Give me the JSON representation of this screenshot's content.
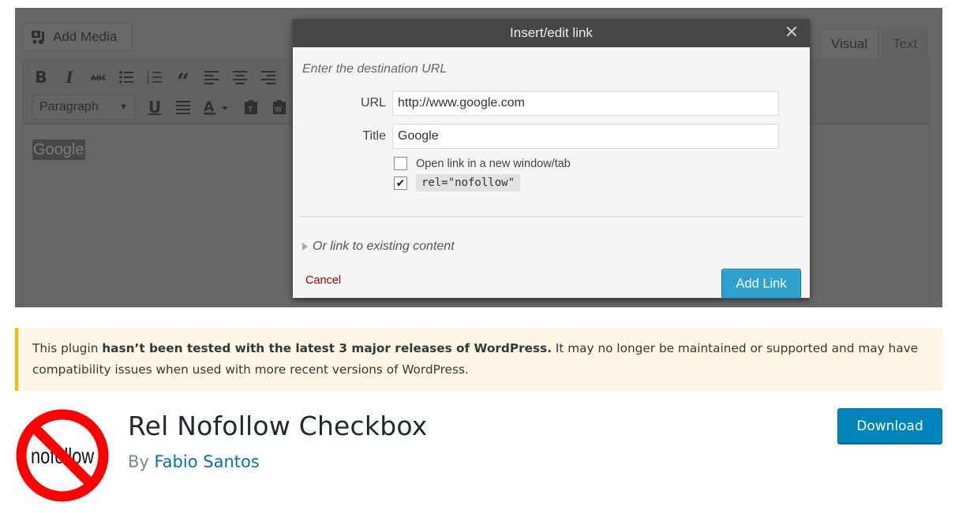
{
  "banner": {
    "add_media_label": "Add Media",
    "tabs": [
      {
        "label": "Visual",
        "active": true
      },
      {
        "label": "Text",
        "active": false
      }
    ],
    "toolbar_row1": [
      "bold-icon",
      "italic-icon",
      "strikethrough-icon",
      "bulleted-list-icon",
      "numbered-list-icon",
      "blockquote-icon",
      "align-left-icon",
      "align-center-icon",
      "align-right-icon"
    ],
    "toolbar_row2": [
      "paragraph-format-select",
      "underline-icon",
      "justify-icon",
      "text-color-icon",
      "paste-as-text-icon",
      "paste-from-word-icon"
    ],
    "format_select_value": "Paragraph",
    "editor_selected_text": "Google"
  },
  "modal": {
    "title": "Insert/edit link",
    "hint": "Enter the destination URL",
    "url_label": "URL",
    "url_value": "http://www.google.com",
    "title_label": "Title",
    "title_value": "Google",
    "new_window_label": "Open link in a new window/tab",
    "new_window_checked": false,
    "nofollow_label": "rel=\"nofollow\"",
    "nofollow_checked": true,
    "existing_content_label": "Or link to existing content",
    "cancel_label": "Cancel",
    "submit_label": "Add Link"
  },
  "notice": {
    "prefix": "This plugin ",
    "bold": "hasn’t been tested with the latest 3 major releases of WordPress.",
    "suffix": " It may no longer be maintained or supported and may have compatibility issues when used with more recent versions of WordPress."
  },
  "plugin": {
    "icon_text": "nofollow",
    "name": "Rel Nofollow Checkbox",
    "by_label": "By",
    "author": "Fabio Santos",
    "download_label": "Download"
  },
  "colors": {
    "notice_border": "#ffb900",
    "notice_bg": "#fef7e5",
    "download_bg": "#0085ba",
    "add_link_bg": "#2ea2cc",
    "cancel_text": "#aa0000",
    "author_link": "#0073aa",
    "prohibition_red": "#ff0000"
  }
}
